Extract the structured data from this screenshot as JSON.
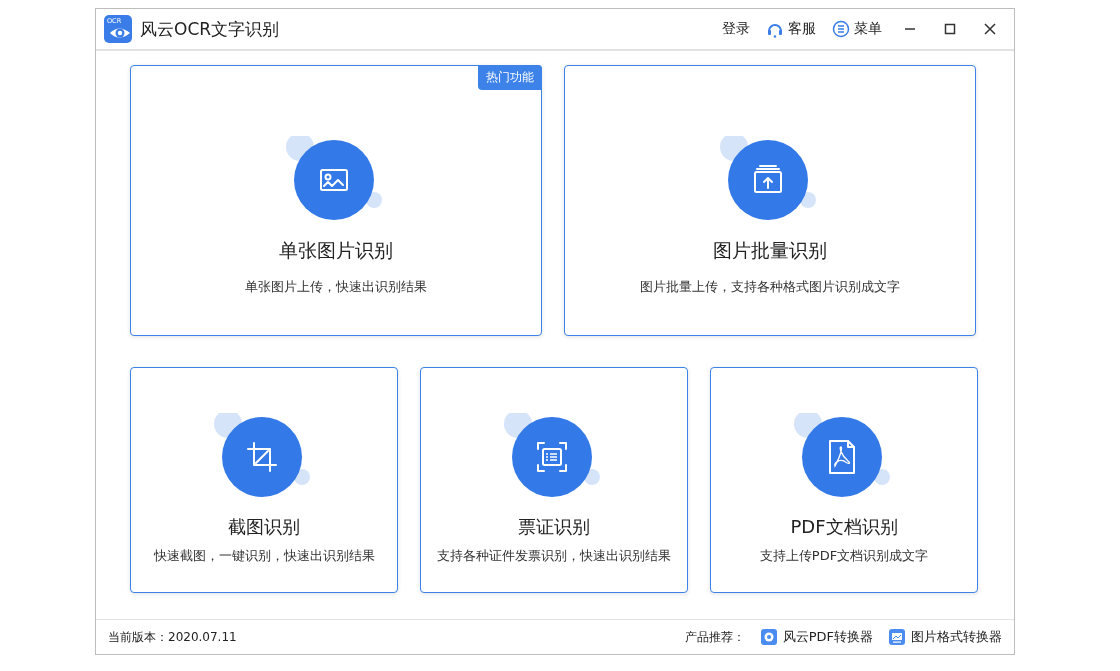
{
  "window": {
    "logo_text": "OCR",
    "title": "风云OCR文字识别",
    "actions": [
      {
        "kind": "text",
        "label": "登录"
      },
      {
        "kind": "headset",
        "label": "客服"
      },
      {
        "kind": "list",
        "label": "菜单"
      }
    ]
  },
  "top_cards": [
    {
      "kind": "image",
      "title": "单张图片识别",
      "description": "单张图片上传，快速出识别结果",
      "badge": "热门功能"
    },
    {
      "kind": "upload",
      "title": "图片批量识别",
      "description": "图片批量上传，支持各种格式图片识别成文字"
    }
  ],
  "bottom_cards": [
    {
      "kind": "crop",
      "title": "截图识别",
      "description": "快速截图，一键识别，快速出识别结果"
    },
    {
      "kind": "scan",
      "title": "票证识别",
      "description": "支持各种证件发票识别，快速出识别结果"
    },
    {
      "kind": "pdf",
      "title": "PDF文档识别",
      "description": "支持上传PDF文档识别成文字"
    }
  ],
  "status_bar": {
    "version": "当前版本：2020.07.11",
    "recommend_label": "产品推荐：",
    "products": [
      {
        "kind": "pdf",
        "label": "风云PDF转换器"
      },
      {
        "kind": "image",
        "label": "图片格式转换器"
      }
    ]
  }
}
